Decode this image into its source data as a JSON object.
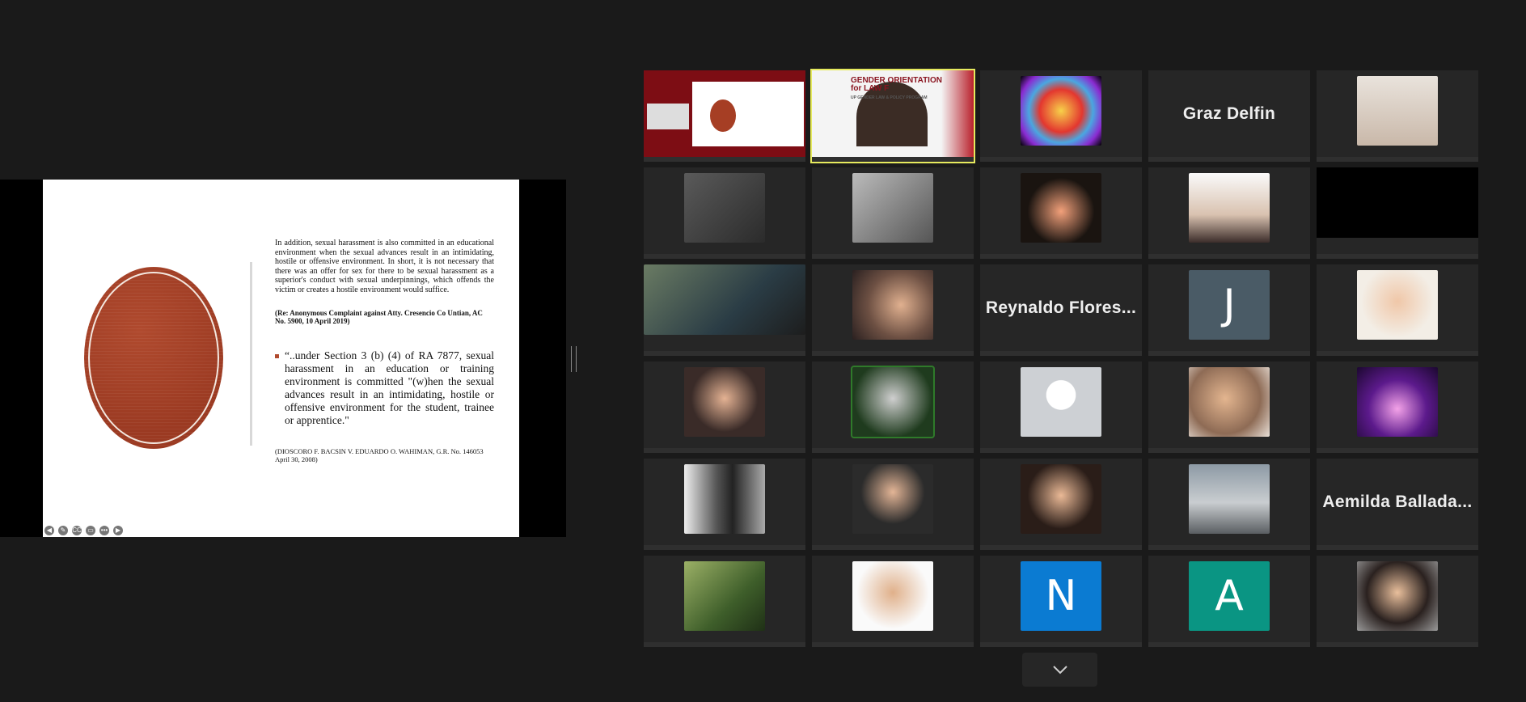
{
  "slide": {
    "paragraph": "In addition, sexual harassment is also committed in an educational environment when the sexual advances result in an intimidating, hostile or offensive environment. In short, it is not necessary that there was an offer for sex for there to be sexual harassment as a superior's conduct with sexual underpinnings, which offends the victim or creates a hostile environment would suffice.",
    "citation_1": "(Re: Anonymous Complaint against Atty. Cresencio Co Untian, AC No. 5900, 10 April 2019)",
    "quote": "“..under Section 3 (b) (4) of RA 7877, sexual harassment in an education or training environment is committed \"(w)hen the sexual advances result in an intimidating, hostile or offensive environment for the student, trainee or apprentice.\"",
    "citation_2": "(DIOSCORO F. BACSIN V. EDUARDO O. WAHIMAN, G.R. No. 146053 April 30, 2008)",
    "tools": [
      "◀",
      "✎",
      "CC",
      "▭",
      "•••",
      "▶"
    ]
  },
  "banner": {
    "line1": "GENDER ORIENTATION",
    "line2": "for LAW F",
    "line3": "UP GENDER LAW & POLICY PROGRAM"
  },
  "participants": {
    "graz": "Graz Delfin",
    "reynaldo": "Reynaldo Flores...",
    "aemilda": "Aemilda Ballada...",
    "j": "J",
    "n": "N",
    "a": "A"
  },
  "colors": {
    "background": "#1a1a1a",
    "tile": "#262626",
    "active_border": "#e6ea5e",
    "j_tile": "#4a5b66",
    "n_tile": "#0b7bd2",
    "a_tile": "#0a9583"
  }
}
